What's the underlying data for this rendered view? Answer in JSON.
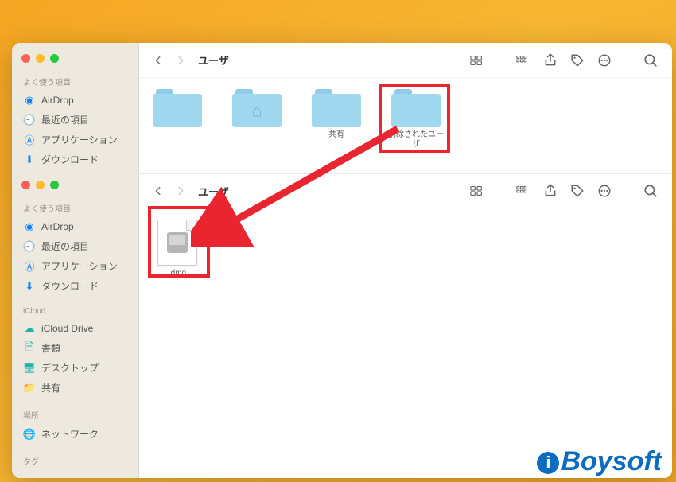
{
  "brand": "Boysoft",
  "sidebar": {
    "section_favorites": "よく使う項目",
    "section_icloud": "iCloud",
    "section_locations": "場所",
    "section_tags": "タグ",
    "favorites": [
      {
        "icon": "airdrop",
        "label": "AirDrop",
        "color": "#0b84ff"
      },
      {
        "icon": "clock",
        "label": "最近の項目",
        "color": "#0b84ff"
      },
      {
        "icon": "apps",
        "label": "アプリケーション",
        "color": "#0b84ff"
      },
      {
        "icon": "download",
        "label": "ダウンロード",
        "color": "#0b84ff"
      }
    ],
    "icloud": [
      {
        "icon": "cloud",
        "label": "iCloud Drive",
        "color": "#1fb2a6"
      },
      {
        "icon": "doc",
        "label": "書類",
        "color": "#1fb2a6"
      },
      {
        "icon": "desktop",
        "label": "デスクトップ",
        "color": "#1fb2a6"
      },
      {
        "icon": "share",
        "label": "共有",
        "color": "#1fb2a6"
      }
    ],
    "locations": [
      {
        "icon": "globe",
        "label": "ネットワーク",
        "color": "#8e8e93"
      }
    ]
  },
  "pane1": {
    "title": "ユーザ",
    "items": [
      {
        "type": "folder",
        "label": ""
      },
      {
        "type": "folder-home",
        "label": ""
      },
      {
        "type": "folder",
        "label": "共有"
      },
      {
        "type": "folder",
        "label": "削除されたユーザ"
      }
    ]
  },
  "pane2": {
    "title": "ユーザ",
    "items": [
      {
        "type": "dmg",
        "label": ".dmg"
      }
    ]
  }
}
